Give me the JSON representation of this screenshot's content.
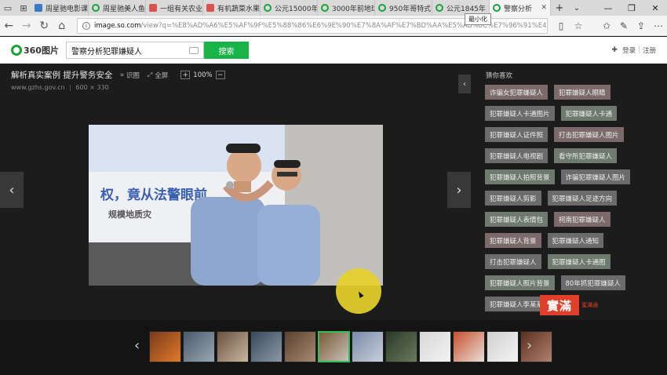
{
  "tabs": [
    {
      "label": "周星驰电影课",
      "color": "#3a78c8",
      "shape": "sq"
    },
    {
      "label": "周星驰美人鱼",
      "color": "#19a33b",
      "shape": "round"
    },
    {
      "label": "一组有关农业",
      "color": "#d9534f",
      "shape": "sq"
    },
    {
      "label": "有机蔬菜水果",
      "color": "#d9534f",
      "shape": "sq"
    },
    {
      "label": "公元15000年",
      "color": "#19a33b",
      "shape": "round"
    },
    {
      "label": "3000年前地球",
      "color": "#19a33b",
      "shape": "round"
    },
    {
      "label": "950年哥特式",
      "color": "#19a33b",
      "shape": "round"
    },
    {
      "label": "公元1845年",
      "color": "#19a33b",
      "shape": "round"
    },
    {
      "label": "警察分析",
      "color": "#19a33b",
      "shape": "round",
      "active": true
    }
  ],
  "tooltip": "最小化",
  "address": {
    "host": "image.so.com",
    "path": "/view?q=%E8%AD%A6%E5%AF%9F%E5%88%86%E6%9E%90%E7%8A%AF%E7%BD%AA%E5%AB%8C%E7%96%91%E4%BA%BA&src=srp&cc"
  },
  "site": {
    "logo_text": "360图片",
    "search_value": "警察分析犯罪嫌疑人",
    "search_button": "搜索",
    "login": "登录",
    "register": "注册"
  },
  "viewer": {
    "title": "解析真实案例 提升警务安全",
    "tool_shitu": "识图",
    "tool_fullscreen": "全屏",
    "zoom": "100%",
    "source": "www.gzhs.gov.cn",
    "size": "600 × 330",
    "photo_banner": "权，竟从法警眼前",
    "photo_banner2": "规模地质灾"
  },
  "side": {
    "title": "猜你喜欢",
    "tags": [
      {
        "label": "诈骗女犯罪嫌疑人",
        "style": "red"
      },
      {
        "label": "犯罪嫌疑人眼睛",
        "style": "red"
      },
      {
        "label": "犯罪嫌疑人卡通图片",
        "style": ""
      },
      {
        "label": "犯罪嫌疑人卡通",
        "style": "grn"
      },
      {
        "label": "犯罪嫌疑人证件照",
        "style": ""
      },
      {
        "label": "打击犯罪嫌疑人图片",
        "style": "red"
      },
      {
        "label": "犯罪嫌疑人电视剧",
        "style": ""
      },
      {
        "label": "看守所犯罪嫌疑人",
        "style": "grn"
      },
      {
        "label": "犯罪嫌疑人拍照背景",
        "style": "grn"
      },
      {
        "label": "诈骗犯罪嫌疑人图片",
        "style": ""
      },
      {
        "label": "犯罪嫌疑人剪影",
        "style": ""
      },
      {
        "label": "犯罪嫌疑人足迹方向",
        "style": ""
      },
      {
        "label": "犯罪嫌疑人表情包",
        "style": "grn"
      },
      {
        "label": "柯南犯罪嫌疑人",
        "style": "red"
      },
      {
        "label": "犯罪嫌疑人背景",
        "style": "red"
      },
      {
        "label": "犯罪嫌疑人通知",
        "style": ""
      },
      {
        "label": "打击犯罪嫌疑人",
        "style": ""
      },
      {
        "label": "犯罪嫌疑人卡通图",
        "style": "grn"
      },
      {
        "label": "犯罪嫌疑人照片背景",
        "style": "grn"
      },
      {
        "label": "80年抓犯罪嫌疑人",
        "style": ""
      },
      {
        "label": "犯罪嫌疑人李某某",
        "style": ""
      }
    ]
  },
  "watermark": {
    "mark": "實滿",
    "text": "蜜滿通"
  },
  "colors": {
    "accent": "#19b449",
    "cursor": "#e6d12a",
    "thumb_active": "#2fbf55"
  }
}
